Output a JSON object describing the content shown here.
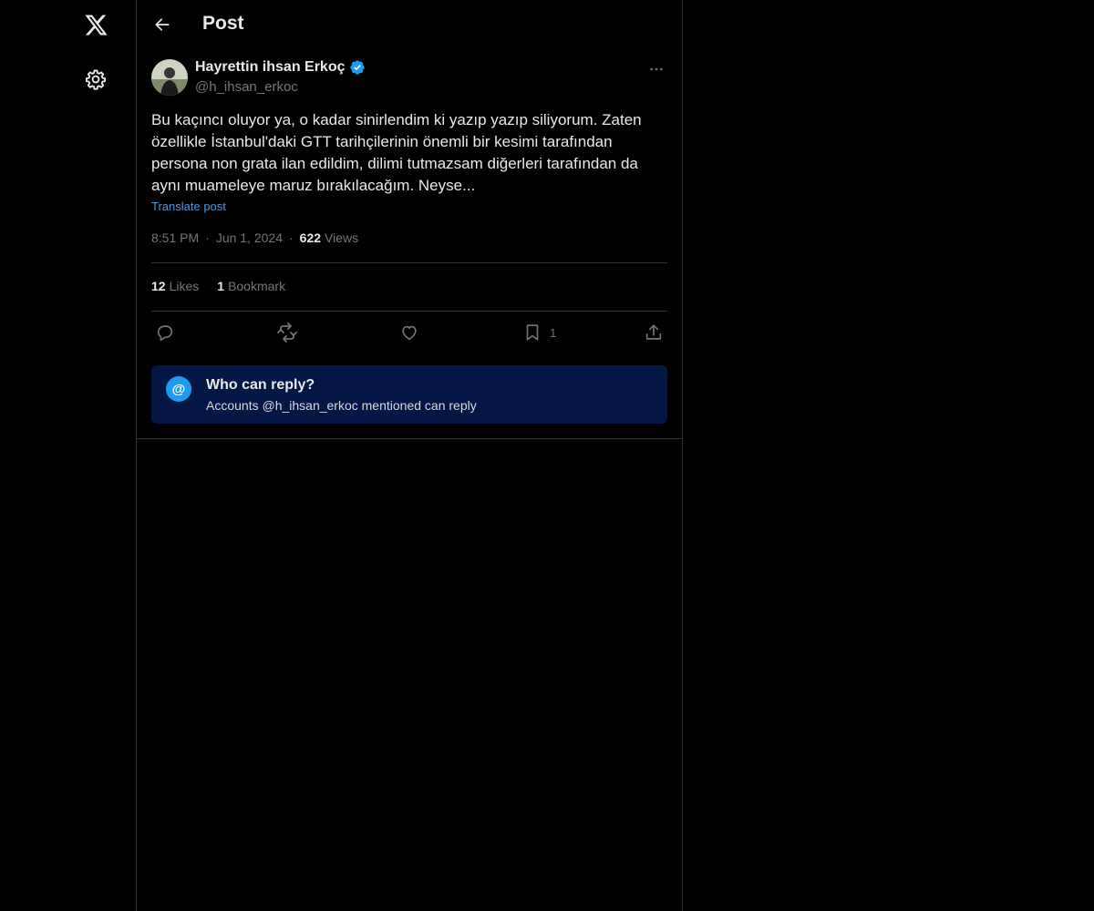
{
  "nav": {
    "logo_icon": "x-logo-icon",
    "settings_icon": "gear-icon"
  },
  "header": {
    "title": "Post",
    "back_icon": "arrow-left-icon"
  },
  "post": {
    "author_name": "Hayrettin ihsan Erkoç",
    "verified": true,
    "handle": "@h_ihsan_erkoc",
    "text": "Bu kaçıncı oluyor ya, o kadar sinirlendim ki yazıp yazıp siliyorum. Zaten özellikle İstanbul'daki GTT tarihçilerinin önemli bir kesimi tarafından persona non grata ilan edildim, dilimi tutmazsam diğerleri tarafından da aynı muameleye maruz bırakılacağım. Neyse...",
    "translate_label": "Translate post",
    "time": "8:51 PM",
    "date": "Jun 1, 2024",
    "views_count": "622",
    "views_label": "Views",
    "separator": "·",
    "likes_count": "12",
    "likes_label": "Likes",
    "bookmarks_count": "1",
    "bookmarks_label": "Bookmark"
  },
  "actions": {
    "reply_icon": "reply-icon",
    "retweet_icon": "retweet-icon",
    "like_icon": "heart-icon",
    "bookmark_icon": "bookmark-icon",
    "bookmark_count": "1",
    "share_icon": "share-icon"
  },
  "reply_restriction": {
    "icon_text": "@",
    "title": "Who can reply?",
    "subtitle": "Accounts @h_ihsan_erkoc mentioned can reply"
  },
  "colors": {
    "background": "#000000",
    "accent": "#1d9bf0",
    "link": "#4d97dc",
    "muted": "#71767b",
    "reply_box": "#041643"
  }
}
